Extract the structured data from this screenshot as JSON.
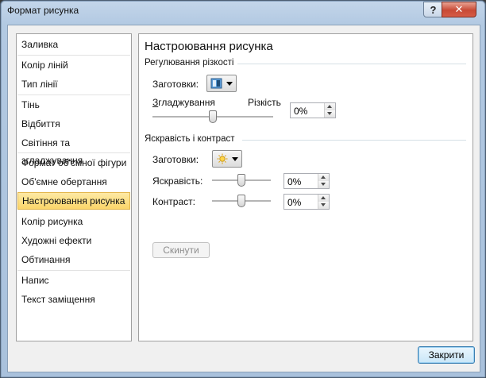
{
  "window": {
    "title": "Формат рисунка",
    "help_label": "?",
    "close_label": "✕"
  },
  "nav": {
    "items": [
      {
        "label": "Заливка"
      },
      {
        "label": "Колір ліній"
      },
      {
        "label": "Тип лінії"
      },
      {
        "label": "Тінь"
      },
      {
        "label": "Відбиття"
      },
      {
        "label": "Світіння та згладжування"
      },
      {
        "label": "Формат об'ємної фігури"
      },
      {
        "label": "Об'ємне обертання"
      },
      {
        "label": "Настроювання рисунка",
        "selected": true
      },
      {
        "label": "Колір рисунка"
      },
      {
        "label": "Художні ефекти"
      },
      {
        "label": "Обтинання"
      },
      {
        "label": "Напис"
      },
      {
        "label": "Текст заміщення"
      }
    ]
  },
  "pane": {
    "title": "Настроювання рисунка",
    "sharpness": {
      "group_label": "Регулювання різкості",
      "presets_label": "Заготовки:",
      "smooth_label": "Згладжування",
      "sharp_label": "Різкість",
      "value": "0%",
      "level": 0.5
    },
    "brightness_contrast": {
      "group_label": "Яскравість і контраст",
      "presets_label": "Заготовки:",
      "brightness_label": "Яскравість:",
      "brightness_value": "0%",
      "brightness_level": 0.5,
      "contrast_label": "Контраст:",
      "contrast_value": "0%",
      "contrast_level": 0.5
    },
    "reset_label": "Скинути"
  },
  "footer": {
    "close_label": "Закрити"
  },
  "colors": {
    "accent": "#fbd66a",
    "window_frame": "#b2c9e2"
  }
}
